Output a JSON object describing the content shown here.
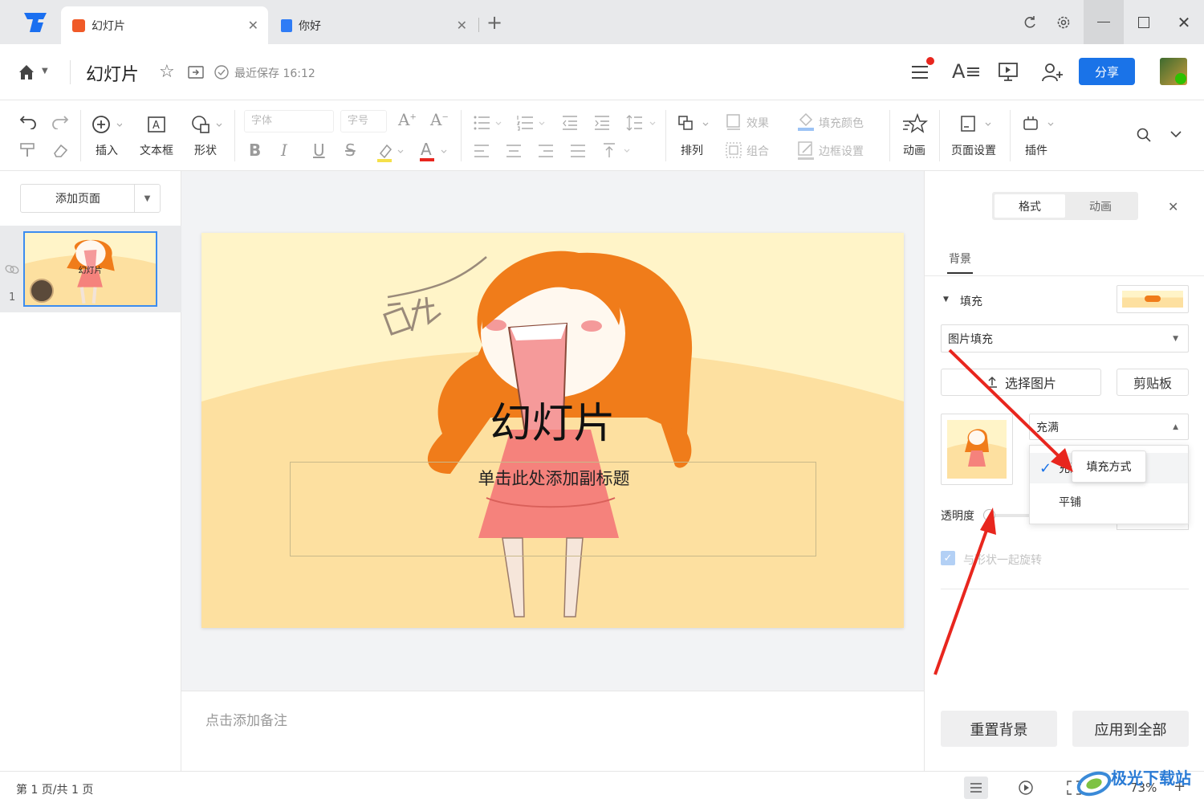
{
  "tabs": [
    {
      "label": "幻灯片",
      "icon": "slides-doc-icon"
    },
    {
      "label": "你好",
      "icon": "text-doc-icon"
    }
  ],
  "header": {
    "title": "幻灯片",
    "save_status": "最近保存 16:12",
    "share_label": "分享"
  },
  "toolbar": {
    "insert": "插入",
    "textbox": "文本框",
    "shape": "形状",
    "font_placeholder": "字体",
    "size_placeholder": "字号",
    "arrange": "排列",
    "effect": "效果",
    "group": "组合",
    "fill_color": "填充颜色",
    "border_settings": "边框设置",
    "animation": "动画",
    "page_setup": "页面设置",
    "plugin": "插件"
  },
  "left_panel": {
    "add_page": "添加页面",
    "slide_number": "1",
    "thumb_title": "幻灯片"
  },
  "slide": {
    "title": "幻灯片",
    "subtitle_placeholder": "单击此处添加副标题",
    "scribble": "吼"
  },
  "notes": {
    "placeholder": "点击添加备注"
  },
  "right_panel": {
    "tabs": [
      "格式",
      "动画"
    ],
    "section": "背景",
    "fill_label": "填充",
    "fill_type": "图片填充",
    "choose_image": "选择图片",
    "clipboard": "剪贴板",
    "fill_mode": "充满",
    "dropdown_options": [
      "充满",
      "平铺"
    ],
    "tooltip": "填充方式",
    "transparency": "透明度",
    "rotate_with_shape": "与形状一起旋转",
    "reset_bg": "重置背景",
    "apply_all": "应用到全部"
  },
  "status": {
    "page_indicator": "第 1 页/共 1 页",
    "zoom": "73%"
  },
  "watermark": "极光下载站",
  "colors": {
    "accent": "#1a73e8",
    "annotation_arrow": "#e8261e",
    "slide_bg": "#fff4c8",
    "hair": "#f07c1a"
  }
}
